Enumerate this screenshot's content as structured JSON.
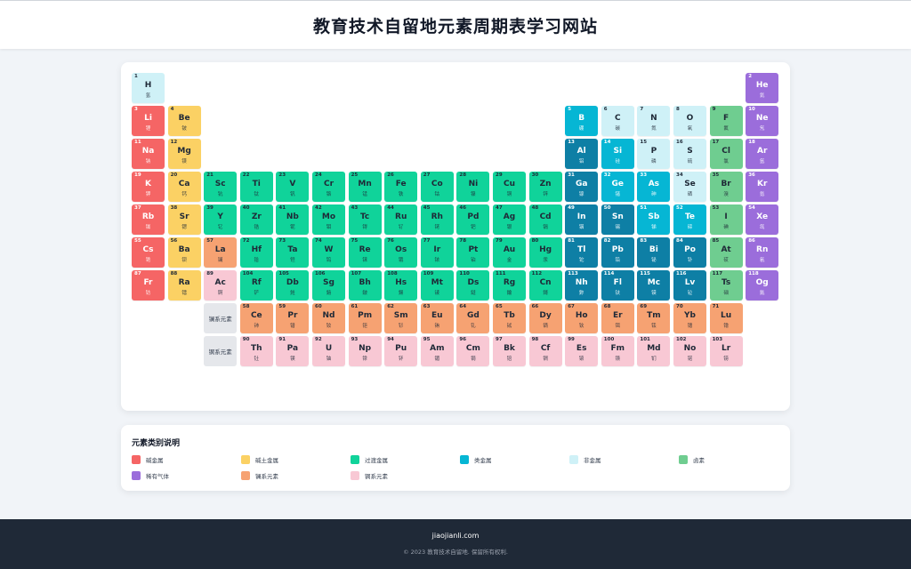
{
  "header": {
    "title": "教育技术自留地元素周期表学习网站"
  },
  "colors": {
    "alkali": "#f56565",
    "alkaline": "#fbd164",
    "transition": "#10d39a",
    "metalloid": "#06b6d4",
    "nonmetal": "#cff1f7",
    "halogen": "#6fcd90",
    "noble": "#9b6ddb",
    "lanthanide": "#f6a272",
    "actinide": "#f8c8d4",
    "poor": "#0e7fa5"
  },
  "elements": [
    {
      "n": 1,
      "s": "H",
      "c": "氢",
      "cat": "nonmetal",
      "r": 1,
      "g": 1
    },
    {
      "n": 2,
      "s": "He",
      "c": "氦",
      "cat": "noble",
      "r": 1,
      "g": 18
    },
    {
      "n": 3,
      "s": "Li",
      "c": "锂",
      "cat": "alkali",
      "r": 2,
      "g": 1
    },
    {
      "n": 4,
      "s": "Be",
      "c": "铍",
      "cat": "alkaline",
      "r": 2,
      "g": 2
    },
    {
      "n": 5,
      "s": "B",
      "c": "硼",
      "cat": "metalloid",
      "r": 2,
      "g": 13
    },
    {
      "n": 6,
      "s": "C",
      "c": "碳",
      "cat": "nonmetal",
      "r": 2,
      "g": 14
    },
    {
      "n": 7,
      "s": "N",
      "c": "氮",
      "cat": "nonmetal",
      "r": 2,
      "g": 15
    },
    {
      "n": 8,
      "s": "O",
      "c": "氧",
      "cat": "nonmetal",
      "r": 2,
      "g": 16
    },
    {
      "n": 9,
      "s": "F",
      "c": "氟",
      "cat": "halogen",
      "r": 2,
      "g": 17
    },
    {
      "n": 10,
      "s": "Ne",
      "c": "氖",
      "cat": "noble",
      "r": 2,
      "g": 18
    },
    {
      "n": 11,
      "s": "Na",
      "c": "钠",
      "cat": "alkali",
      "r": 3,
      "g": 1
    },
    {
      "n": 12,
      "s": "Mg",
      "c": "镁",
      "cat": "alkaline",
      "r": 3,
      "g": 2
    },
    {
      "n": 13,
      "s": "Al",
      "c": "铝",
      "cat": "poor",
      "r": 3,
      "g": 13
    },
    {
      "n": 14,
      "s": "Si",
      "c": "硅",
      "cat": "metalloid",
      "r": 3,
      "g": 14
    },
    {
      "n": 15,
      "s": "P",
      "c": "磷",
      "cat": "nonmetal",
      "r": 3,
      "g": 15
    },
    {
      "n": 16,
      "s": "S",
      "c": "硫",
      "cat": "nonmetal",
      "r": 3,
      "g": 16
    },
    {
      "n": 17,
      "s": "Cl",
      "c": "氯",
      "cat": "halogen",
      "r": 3,
      "g": 17
    },
    {
      "n": 18,
      "s": "Ar",
      "c": "氩",
      "cat": "noble",
      "r": 3,
      "g": 18
    },
    {
      "n": 19,
      "s": "K",
      "c": "钾",
      "cat": "alkali",
      "r": 4,
      "g": 1
    },
    {
      "n": 20,
      "s": "Ca",
      "c": "钙",
      "cat": "alkaline",
      "r": 4,
      "g": 2
    },
    {
      "n": 21,
      "s": "Sc",
      "c": "钪",
      "cat": "transition",
      "r": 4,
      "g": 3
    },
    {
      "n": 22,
      "s": "Ti",
      "c": "钛",
      "cat": "transition",
      "r": 4,
      "g": 4
    },
    {
      "n": 23,
      "s": "V",
      "c": "钒",
      "cat": "transition",
      "r": 4,
      "g": 5
    },
    {
      "n": 24,
      "s": "Cr",
      "c": "铬",
      "cat": "transition",
      "r": 4,
      "g": 6
    },
    {
      "n": 25,
      "s": "Mn",
      "c": "锰",
      "cat": "transition",
      "r": 4,
      "g": 7
    },
    {
      "n": 26,
      "s": "Fe",
      "c": "铁",
      "cat": "transition",
      "r": 4,
      "g": 8
    },
    {
      "n": 27,
      "s": "Co",
      "c": "钴",
      "cat": "transition",
      "r": 4,
      "g": 9
    },
    {
      "n": 28,
      "s": "Ni",
      "c": "镍",
      "cat": "transition",
      "r": 4,
      "g": 10
    },
    {
      "n": 29,
      "s": "Cu",
      "c": "铜",
      "cat": "transition",
      "r": 4,
      "g": 11
    },
    {
      "n": 30,
      "s": "Zn",
      "c": "锌",
      "cat": "transition",
      "r": 4,
      "g": 12
    },
    {
      "n": 31,
      "s": "Ga",
      "c": "镓",
      "cat": "poor",
      "r": 4,
      "g": 13
    },
    {
      "n": 32,
      "s": "Ge",
      "c": "锗",
      "cat": "metalloid",
      "r": 4,
      "g": 14
    },
    {
      "n": 33,
      "s": "As",
      "c": "砷",
      "cat": "metalloid",
      "r": 4,
      "g": 15
    },
    {
      "n": 34,
      "s": "Se",
      "c": "硒",
      "cat": "nonmetal",
      "r": 4,
      "g": 16
    },
    {
      "n": 35,
      "s": "Br",
      "c": "溴",
      "cat": "halogen",
      "r": 4,
      "g": 17
    },
    {
      "n": 36,
      "s": "Kr",
      "c": "氪",
      "cat": "noble",
      "r": 4,
      "g": 18
    },
    {
      "n": 37,
      "s": "Rb",
      "c": "铷",
      "cat": "alkali",
      "r": 5,
      "g": 1
    },
    {
      "n": 38,
      "s": "Sr",
      "c": "锶",
      "cat": "alkaline",
      "r": 5,
      "g": 2
    },
    {
      "n": 39,
      "s": "Y",
      "c": "钇",
      "cat": "transition",
      "r": 5,
      "g": 3
    },
    {
      "n": 40,
      "s": "Zr",
      "c": "锆",
      "cat": "transition",
      "r": 5,
      "g": 4
    },
    {
      "n": 41,
      "s": "Nb",
      "c": "铌",
      "cat": "transition",
      "r": 5,
      "g": 5
    },
    {
      "n": 42,
      "s": "Mo",
      "c": "钼",
      "cat": "transition",
      "r": 5,
      "g": 6
    },
    {
      "n": 43,
      "s": "Tc",
      "c": "锝",
      "cat": "transition",
      "r": 5,
      "g": 7
    },
    {
      "n": 44,
      "s": "Ru",
      "c": "钌",
      "cat": "transition",
      "r": 5,
      "g": 8
    },
    {
      "n": 45,
      "s": "Rh",
      "c": "铑",
      "cat": "transition",
      "r": 5,
      "g": 9
    },
    {
      "n": 46,
      "s": "Pd",
      "c": "钯",
      "cat": "transition",
      "r": 5,
      "g": 10
    },
    {
      "n": 47,
      "s": "Ag",
      "c": "银",
      "cat": "transition",
      "r": 5,
      "g": 11
    },
    {
      "n": 48,
      "s": "Cd",
      "c": "镉",
      "cat": "transition",
      "r": 5,
      "g": 12
    },
    {
      "n": 49,
      "s": "In",
      "c": "铟",
      "cat": "poor",
      "r": 5,
      "g": 13
    },
    {
      "n": 50,
      "s": "Sn",
      "c": "锡",
      "cat": "poor",
      "r": 5,
      "g": 14
    },
    {
      "n": 51,
      "s": "Sb",
      "c": "锑",
      "cat": "metalloid",
      "r": 5,
      "g": 15
    },
    {
      "n": 52,
      "s": "Te",
      "c": "碲",
      "cat": "metalloid",
      "r": 5,
      "g": 16
    },
    {
      "n": 53,
      "s": "I",
      "c": "碘",
      "cat": "halogen",
      "r": 5,
      "g": 17
    },
    {
      "n": 54,
      "s": "Xe",
      "c": "氙",
      "cat": "noble",
      "r": 5,
      "g": 18
    },
    {
      "n": 55,
      "s": "Cs",
      "c": "铯",
      "cat": "alkali",
      "r": 6,
      "g": 1
    },
    {
      "n": 56,
      "s": "Ba",
      "c": "钡",
      "cat": "alkaline",
      "r": 6,
      "g": 2
    },
    {
      "n": 57,
      "s": "La",
      "c": "镧",
      "cat": "lanthanide",
      "r": 6,
      "g": 3
    },
    {
      "n": 72,
      "s": "Hf",
      "c": "铪",
      "cat": "transition",
      "r": 6,
      "g": 4
    },
    {
      "n": 73,
      "s": "Ta",
      "c": "钽",
      "cat": "transition",
      "r": 6,
      "g": 5
    },
    {
      "n": 74,
      "s": "W",
      "c": "钨",
      "cat": "transition",
      "r": 6,
      "g": 6
    },
    {
      "n": 75,
      "s": "Re",
      "c": "铼",
      "cat": "transition",
      "r": 6,
      "g": 7
    },
    {
      "n": 76,
      "s": "Os",
      "c": "锇",
      "cat": "transition",
      "r": 6,
      "g": 8
    },
    {
      "n": 77,
      "s": "Ir",
      "c": "铱",
      "cat": "transition",
      "r": 6,
      "g": 9
    },
    {
      "n": 78,
      "s": "Pt",
      "c": "铂",
      "cat": "transition",
      "r": 6,
      "g": 10
    },
    {
      "n": 79,
      "s": "Au",
      "c": "金",
      "cat": "transition",
      "r": 6,
      "g": 11
    },
    {
      "n": 80,
      "s": "Hg",
      "c": "汞",
      "cat": "transition",
      "r": 6,
      "g": 12
    },
    {
      "n": 81,
      "s": "Tl",
      "c": "铊",
      "cat": "poor",
      "r": 6,
      "g": 13
    },
    {
      "n": 82,
      "s": "Pb",
      "c": "铅",
      "cat": "poor",
      "r": 6,
      "g": 14
    },
    {
      "n": 83,
      "s": "Bi",
      "c": "铋",
      "cat": "poor",
      "r": 6,
      "g": 15
    },
    {
      "n": 84,
      "s": "Po",
      "c": "钋",
      "cat": "poor",
      "r": 6,
      "g": 16
    },
    {
      "n": 85,
      "s": "At",
      "c": "砹",
      "cat": "halogen",
      "r": 6,
      "g": 17
    },
    {
      "n": 86,
      "s": "Rn",
      "c": "氡",
      "cat": "noble",
      "r": 6,
      "g": 18
    },
    {
      "n": 87,
      "s": "Fr",
      "c": "钫",
      "cat": "alkali",
      "r": 7,
      "g": 1
    },
    {
      "n": 88,
      "s": "Ra",
      "c": "镭",
      "cat": "alkaline",
      "r": 7,
      "g": 2
    },
    {
      "n": 89,
      "s": "Ac",
      "c": "锕",
      "cat": "actinide",
      "r": 7,
      "g": 3
    },
    {
      "n": 104,
      "s": "Rf",
      "c": "铲",
      "cat": "transition",
      "r": 7,
      "g": 4
    },
    {
      "n": 105,
      "s": "Db",
      "c": "𨧀",
      "cat": "transition",
      "r": 7,
      "g": 5
    },
    {
      "n": 106,
      "s": "Sg",
      "c": "𨭎",
      "cat": "transition",
      "r": 7,
      "g": 6
    },
    {
      "n": 107,
      "s": "Bh",
      "c": "𨨏",
      "cat": "transition",
      "r": 7,
      "g": 7
    },
    {
      "n": 108,
      "s": "Hs",
      "c": "𨭆",
      "cat": "transition",
      "r": 7,
      "g": 8
    },
    {
      "n": 109,
      "s": "Mt",
      "c": "鿏",
      "cat": "transition",
      "r": 7,
      "g": 9
    },
    {
      "n": 110,
      "s": "Ds",
      "c": "鐽",
      "cat": "transition",
      "r": 7,
      "g": 10
    },
    {
      "n": 111,
      "s": "Rg",
      "c": "錀",
      "cat": "transition",
      "r": 7,
      "g": 11
    },
    {
      "n": 112,
      "s": "Cn",
      "c": "鎶",
      "cat": "transition",
      "r": 7,
      "g": 12
    },
    {
      "n": 113,
      "s": "Nh",
      "c": "鉨",
      "cat": "poor",
      "r": 7,
      "g": 13
    },
    {
      "n": 114,
      "s": "Fl",
      "c": "𫓧",
      "cat": "poor",
      "r": 7,
      "g": 14
    },
    {
      "n": 115,
      "s": "Mc",
      "c": "镆",
      "cat": "poor",
      "r": 7,
      "g": 15
    },
    {
      "n": 116,
      "s": "Lv",
      "c": "𫟷",
      "cat": "poor",
      "r": 7,
      "g": 16
    },
    {
      "n": 117,
      "s": "Ts",
      "c": "鿬",
      "cat": "halogen",
      "r": 7,
      "g": 17
    },
    {
      "n": 118,
      "s": "Og",
      "c": "鿫",
      "cat": "noble",
      "r": 7,
      "g": 18
    },
    {
      "n": 58,
      "s": "Ce",
      "c": "铈",
      "cat": "lanthanide",
      "r": 8,
      "g": 4
    },
    {
      "n": 59,
      "s": "Pr",
      "c": "镨",
      "cat": "lanthanide",
      "r": 8,
      "g": 5
    },
    {
      "n": 60,
      "s": "Nd",
      "c": "钕",
      "cat": "lanthanide",
      "r": 8,
      "g": 6
    },
    {
      "n": 61,
      "s": "Pm",
      "c": "钷",
      "cat": "lanthanide",
      "r": 8,
      "g": 7
    },
    {
      "n": 62,
      "s": "Sm",
      "c": "钐",
      "cat": "lanthanide",
      "r": 8,
      "g": 8
    },
    {
      "n": 63,
      "s": "Eu",
      "c": "铕",
      "cat": "lanthanide",
      "r": 8,
      "g": 9
    },
    {
      "n": 64,
      "s": "Gd",
      "c": "钆",
      "cat": "lanthanide",
      "r": 8,
      "g": 10
    },
    {
      "n": 65,
      "s": "Tb",
      "c": "铽",
      "cat": "lanthanide",
      "r": 8,
      "g": 11
    },
    {
      "n": 66,
      "s": "Dy",
      "c": "镝",
      "cat": "lanthanide",
      "r": 8,
      "g": 12
    },
    {
      "n": 67,
      "s": "Ho",
      "c": "钬",
      "cat": "lanthanide",
      "r": 8,
      "g": 13
    },
    {
      "n": 68,
      "s": "Er",
      "c": "铒",
      "cat": "lanthanide",
      "r": 8,
      "g": 14
    },
    {
      "n": 69,
      "s": "Tm",
      "c": "铥",
      "cat": "lanthanide",
      "r": 8,
      "g": 15
    },
    {
      "n": 70,
      "s": "Yb",
      "c": "镱",
      "cat": "lanthanide",
      "r": 8,
      "g": 16
    },
    {
      "n": 71,
      "s": "Lu",
      "c": "镥",
      "cat": "lanthanide",
      "r": 8,
      "g": 17
    },
    {
      "n": 90,
      "s": "Th",
      "c": "钍",
      "cat": "actinide",
      "r": 9,
      "g": 4
    },
    {
      "n": 91,
      "s": "Pa",
      "c": "镤",
      "cat": "actinide",
      "r": 9,
      "g": 5
    },
    {
      "n": 92,
      "s": "U",
      "c": "铀",
      "cat": "actinide",
      "r": 9,
      "g": 6
    },
    {
      "n": 93,
      "s": "Np",
      "c": "镎",
      "cat": "actinide",
      "r": 9,
      "g": 7
    },
    {
      "n": 94,
      "s": "Pu",
      "c": "钚",
      "cat": "actinide",
      "r": 9,
      "g": 8
    },
    {
      "n": 95,
      "s": "Am",
      "c": "镅",
      "cat": "actinide",
      "r": 9,
      "g": 9
    },
    {
      "n": 96,
      "s": "Cm",
      "c": "锔",
      "cat": "actinide",
      "r": 9,
      "g": 10
    },
    {
      "n": 97,
      "s": "Bk",
      "c": "锫",
      "cat": "actinide",
      "r": 9,
      "g": 11
    },
    {
      "n": 98,
      "s": "Cf",
      "c": "锎",
      "cat": "actinide",
      "r": 9,
      "g": 12
    },
    {
      "n": 99,
      "s": "Es",
      "c": "锿",
      "cat": "actinide",
      "r": 9,
      "g": 13
    },
    {
      "n": 100,
      "s": "Fm",
      "c": "镄",
      "cat": "actinide",
      "r": 9,
      "g": 14
    },
    {
      "n": 101,
      "s": "Md",
      "c": "钔",
      "cat": "actinide",
      "r": 9,
      "g": 15
    },
    {
      "n": 102,
      "s": "No",
      "c": "锘",
      "cat": "actinide",
      "r": 9,
      "g": 16
    },
    {
      "n": 103,
      "s": "Lr",
      "c": "铹",
      "cat": "actinide",
      "r": 9,
      "g": 17
    }
  ],
  "series_labels": [
    {
      "text": "镧系元素",
      "r": 8,
      "g": 3
    },
    {
      "text": "锕系元素",
      "r": 9,
      "g": 3
    }
  ],
  "legend": {
    "title": "元素类别说明",
    "items": [
      {
        "label": "碱金属",
        "cat": "alkali"
      },
      {
        "label": "碱土金属",
        "cat": "alkaline"
      },
      {
        "label": "过渡金属",
        "cat": "transition"
      },
      {
        "label": "类金属",
        "cat": "metalloid"
      },
      {
        "label": "非金属",
        "cat": "nonmetal"
      },
      {
        "label": "卤素",
        "cat": "halogen"
      },
      {
        "label": "稀有气体",
        "cat": "noble"
      },
      {
        "label": "镧系元素",
        "cat": "lanthanide"
      },
      {
        "label": "锕系元素",
        "cat": "actinide"
      }
    ]
  },
  "footer": {
    "site": "jiaojianli.com",
    "copyright": "© 2023 教育技术自留地. 保留所有权利."
  }
}
